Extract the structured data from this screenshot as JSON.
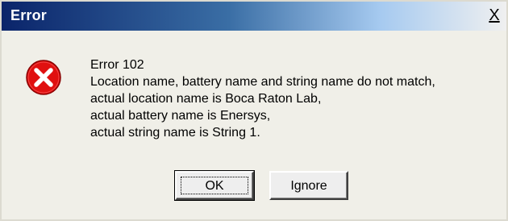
{
  "dialog": {
    "title": "Error",
    "close_glyph": "X",
    "icon": "error-icon",
    "message_lines": [
      "Error 102",
      "Location name, battery name and string name do not match,",
      "actual location name is Boca Raton Lab,",
      "actual battery name is Enersys,",
      "actual string name is String 1."
    ],
    "buttons": {
      "ok_label": "OK",
      "ignore_label": "Ignore"
    }
  },
  "colors": {
    "title_gradient_start": "#0a246a",
    "title_gradient_end": "#f0f0f0",
    "icon_red": "#e01010"
  }
}
